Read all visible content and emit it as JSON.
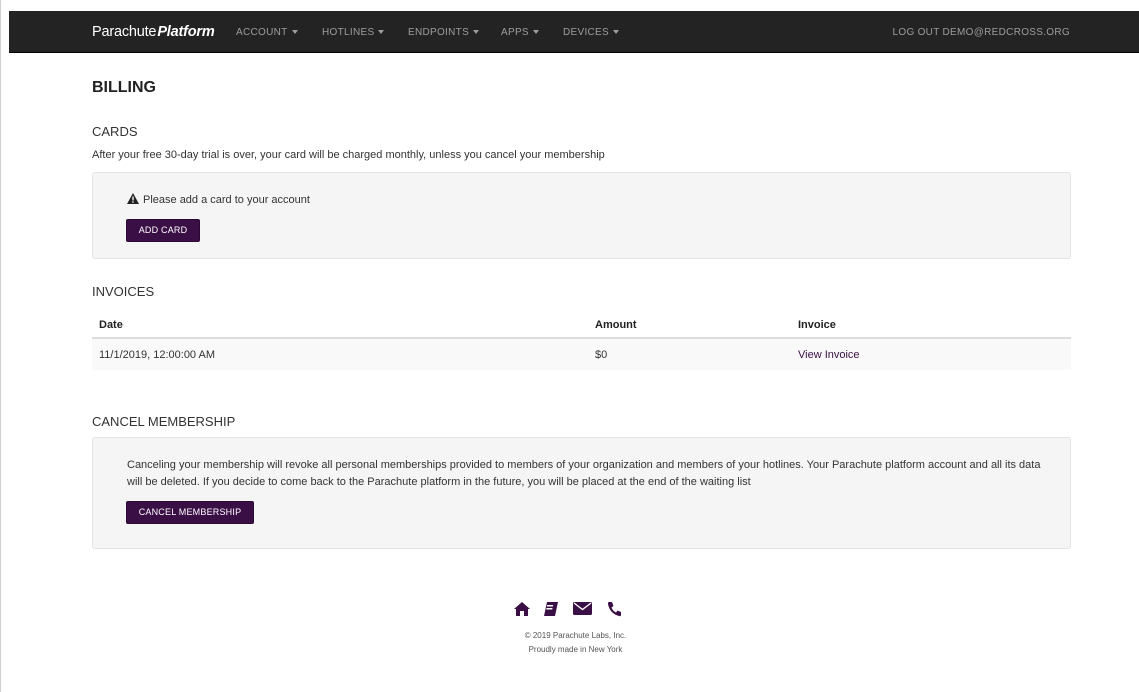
{
  "navbar": {
    "brand_part1": "Parachute",
    "brand_part2": "Platform",
    "items": [
      {
        "label": "ACCOUNT"
      },
      {
        "label": "HOTLINES"
      },
      {
        "label": "ENDPOINTS"
      },
      {
        "label": "APPS"
      },
      {
        "label": "DEVICES"
      }
    ],
    "logout": "LOG OUT DEMO@REDCROSS.ORG"
  },
  "page": {
    "title": "BILLING"
  },
  "cards": {
    "title": "CARDS",
    "description": "After your free 30-day trial is over, your card will be charged monthly, unless you cancel your membership",
    "warning": "Please add a card to your account",
    "add_card_label": "ADD CARD"
  },
  "invoices": {
    "title": "INVOICES",
    "columns": [
      "Date",
      "Amount",
      "Invoice"
    ],
    "rows": [
      {
        "date": "11/1/2019, 12:00:00 AM",
        "amount": "$0",
        "invoice": "View Invoice"
      }
    ]
  },
  "cancel": {
    "title": "CANCEL MEMBERSHIP",
    "text": "Canceling your membership will revoke all personal memberships provided to members of your organization and members of your hotlines. Your Parachute platform account and all its data will be deleted. If you decide to come back to the Parachute platform in the future, you will be placed at the end of the waiting list",
    "button_label": "CANCEL MEMBERSHIP"
  },
  "footer": {
    "icons": [
      "home-icon",
      "book-icon",
      "envelope-icon",
      "phone-icon"
    ],
    "copyright": "© 2019 Parachute Labs, Inc.",
    "tagline": "Proudly made in New York"
  },
  "colors": {
    "navbar_bg": "#232323",
    "accent": "#3a0f45",
    "well_bg": "#f5f5f5"
  }
}
